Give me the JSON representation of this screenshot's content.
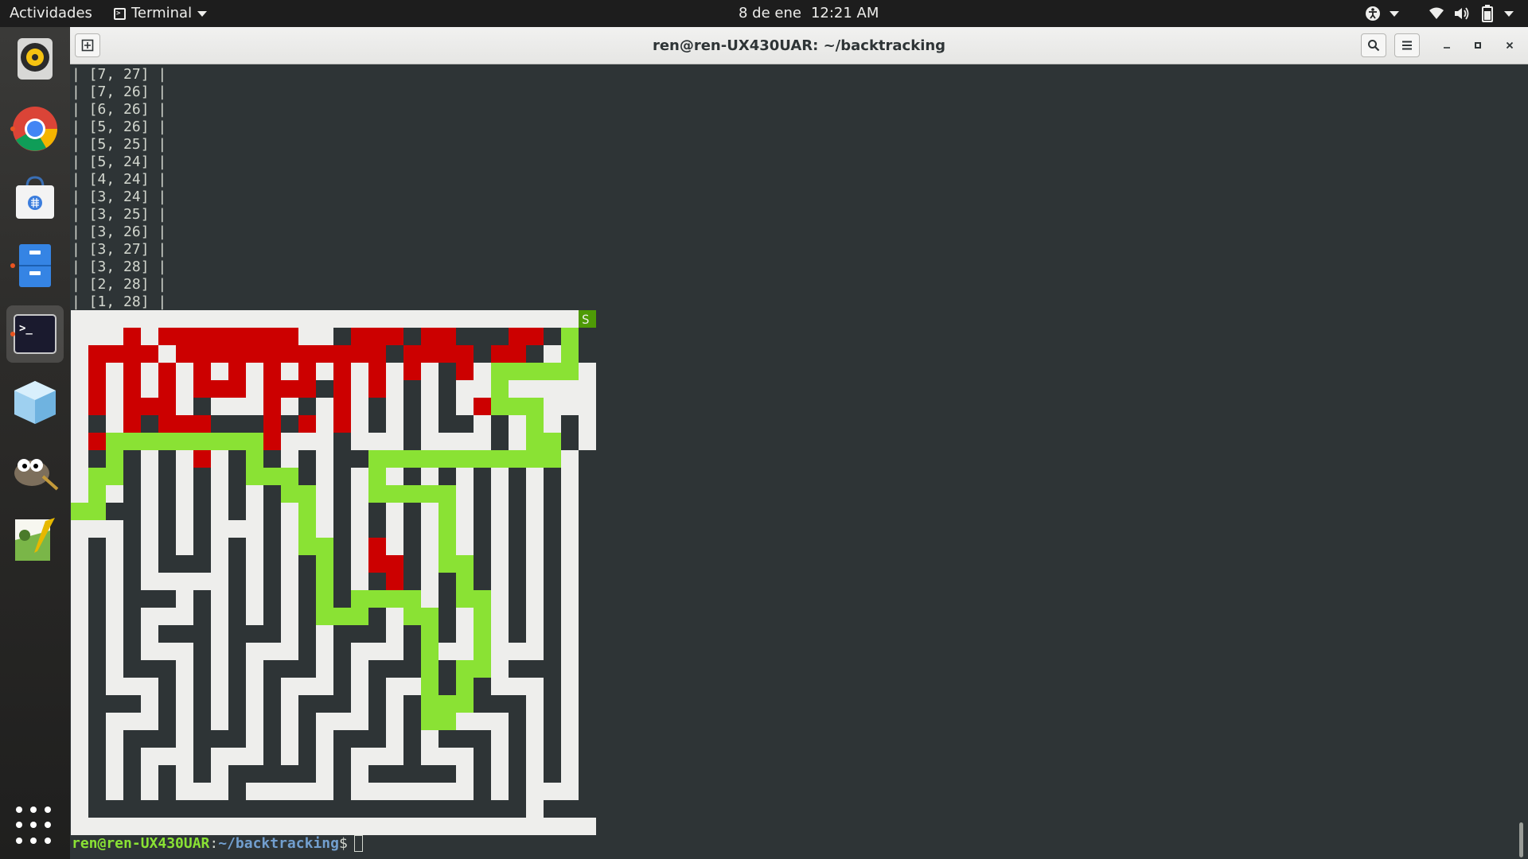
{
  "topbar": {
    "activities": "Actividades",
    "app_menu_label": "Terminal",
    "date": "8 de ene",
    "time": "12:21 AM",
    "tray_icons": [
      "accessibility-icon",
      "wifi-icon",
      "volume-icon",
      "battery-icon"
    ]
  },
  "dock": {
    "apps": [
      {
        "name": "rhythmbox",
        "running": false
      },
      {
        "name": "chrome",
        "running": true
      },
      {
        "name": "software-store",
        "running": false
      },
      {
        "name": "files",
        "running": true
      },
      {
        "name": "terminal",
        "running": true,
        "active": true
      },
      {
        "name": "virtual-box-cube",
        "running": false
      },
      {
        "name": "gimp",
        "running": false
      },
      {
        "name": "office-writer",
        "running": false
      }
    ]
  },
  "window": {
    "title": "ren@ren-UX430UAR: ~/backtracking"
  },
  "terminal": {
    "output_lines": [
      "| [7, 27] |",
      "| [7, 26] |",
      "| [6, 26] |",
      "| [5, 26] |",
      "| [5, 25] |",
      "| [5, 24] |",
      "| [4, 24] |",
      "| [3, 24] |",
      "| [3, 25] |",
      "| [3, 26] |",
      "| [3, 27] |",
      "| [3, 28] |",
      "| [2, 28] |",
      "| [1, 28] |"
    ],
    "prompt": {
      "user": "ren@ren-UX430UAR",
      "sep": ":",
      "path": "~/backtracking",
      "dollar": "$"
    }
  },
  "maze": {
    "start_label": "S",
    "colors": {
      "open": "#eeeeec",
      "wall": "#2e3436",
      "solution": "#8ae234",
      "dead_end": "#cc0000",
      "start": "#4e9a06"
    },
    "grid": [
      "..............................",
      "...#..#######..#####.#####.###",
      ".####.###########.####.####.##",
      ".#...#.#.#.#...#.#...#..#.....",
      ".#...#.#.#.#.###.#.#.#..#.....",
      ".#...#.#...#.#.#.#.#.#..#.#...",
      ".#.###.#######.#.#.#.##.#.#.#.",
      ".#.#.###.#.#...#...#....#.#.#.",
      ".#.#.#.#.#.#.#.#####.##..#.#.#",
      ".#.#.#.#.#.#.#.#.#.#.#.#.#.#.#",
      ".#.#.#.#.#.#.#.#.#.#.#.#.#.#.#",
      ".###.#.#.#.#.#.#.#.#.#.#.#.#.#",
      "...#.#.#...#.#.#.#.#.#.#.#.#.#",
      ".#.#.#.#.#.#.#.#.#.#.#.#.#.#.#",
      ".#.#.###.#.#.#.#.#.#.#.#.#.#.#",
      ".#.#.....#.#.#.#.#.#.#.#.#.#.#",
      ".#.###.#.#.#.#.#.#.#.#.#.#.#.#",
      ".#.#...#.#.#.#...#.#.#.#.#.#.#",
      ".#.#.###.###.#.###.#.#.#.#.#.#",
      ".#.#...#.#...#.#...#...#...#.#",
      ".#.###.#.#.###.#.#####.#.###.#",
      ".#...#.#.#.#...#.#...#.#...#.#",
      ".###.#.#.#.#.###.#.#.#.###.#.#",
      ".#...#.#.#.#.#...#.#.#...#.#.#",
      ".#.###.###.#.#.###.#.###.#.#.#",
      ".#.#...#...#.#.#...#...#.#.#.#",
      ".#.#.#.#.#####.#.#####.#.#.#.#",
      ".#.#.#...#.....#.......#.#...#",
      ".#########################.###",
      ".............................."
    ],
    "solution_path": [
      [
        0,
        29
      ],
      [
        1,
        28
      ],
      [
        2,
        28
      ],
      [
        3,
        28
      ],
      [
        3,
        27
      ],
      [
        3,
        26
      ],
      [
        3,
        25
      ],
      [
        3,
        24
      ],
      [
        4,
        24
      ],
      [
        5,
        24
      ],
      [
        5,
        25
      ],
      [
        5,
        26
      ],
      [
        6,
        26
      ],
      [
        7,
        26
      ],
      [
        7,
        27
      ],
      [
        8,
        27
      ],
      [
        8,
        26
      ],
      [
        8,
        25
      ],
      [
        8,
        24
      ],
      [
        8,
        23
      ],
      [
        8,
        22
      ],
      [
        8,
        21
      ],
      [
        8,
        20
      ],
      [
        8,
        19
      ],
      [
        8,
        18
      ],
      [
        8,
        17
      ],
      [
        9,
        17
      ],
      [
        10,
        17
      ],
      [
        10,
        18
      ],
      [
        10,
        19
      ],
      [
        10,
        20
      ],
      [
        10,
        21
      ],
      [
        11,
        21
      ],
      [
        12,
        21
      ],
      [
        13,
        21
      ],
      [
        14,
        21
      ],
      [
        14,
        22
      ],
      [
        15,
        22
      ],
      [
        16,
        22
      ],
      [
        16,
        23
      ],
      [
        17,
        23
      ],
      [
        18,
        23
      ],
      [
        19,
        23
      ],
      [
        20,
        23
      ],
      [
        20,
        22
      ],
      [
        21,
        22
      ],
      [
        22,
        22
      ],
      [
        22,
        21
      ],
      [
        23,
        21
      ],
      [
        23,
        20
      ],
      [
        22,
        20
      ],
      [
        21,
        20
      ],
      [
        20,
        20
      ],
      [
        19,
        20
      ],
      [
        18,
        20
      ],
      [
        17,
        20
      ],
      [
        17,
        19
      ],
      [
        16,
        19
      ],
      [
        16,
        18
      ],
      [
        16,
        17
      ],
      [
        16,
        16
      ],
      [
        17,
        16
      ],
      [
        17,
        15
      ],
      [
        17,
        14
      ],
      [
        16,
        14
      ],
      [
        15,
        14
      ],
      [
        14,
        14
      ],
      [
        13,
        14
      ],
      [
        13,
        13
      ],
      [
        12,
        13
      ],
      [
        11,
        13
      ],
      [
        10,
        13
      ],
      [
        10,
        12
      ],
      [
        9,
        12
      ],
      [
        9,
        11
      ],
      [
        9,
        10
      ],
      [
        8,
        10
      ],
      [
        7,
        10
      ],
      [
        7,
        9
      ],
      [
        7,
        8
      ],
      [
        7,
        7
      ],
      [
        7,
        6
      ],
      [
        7,
        5
      ],
      [
        7,
        4
      ],
      [
        7,
        3
      ],
      [
        7,
        2
      ],
      [
        8,
        2
      ],
      [
        9,
        2
      ],
      [
        9,
        1
      ],
      [
        10,
        1
      ],
      [
        11,
        1
      ],
      [
        11,
        0
      ]
    ],
    "dead_ends": [
      [
        1,
        3
      ],
      [
        1,
        5
      ],
      [
        1,
        6
      ],
      [
        1,
        7
      ],
      [
        1,
        8
      ],
      [
        1,
        9
      ],
      [
        1,
        10
      ],
      [
        1,
        11
      ],
      [
        1,
        12
      ],
      [
        1,
        16
      ],
      [
        1,
        17
      ],
      [
        1,
        18
      ],
      [
        1,
        20
      ],
      [
        1,
        21
      ],
      [
        1,
        25
      ],
      [
        1,
        26
      ],
      [
        2,
        1
      ],
      [
        2,
        2
      ],
      [
        2,
        3
      ],
      [
        2,
        4
      ],
      [
        2,
        6
      ],
      [
        2,
        7
      ],
      [
        2,
        8
      ],
      [
        2,
        9
      ],
      [
        2,
        10
      ],
      [
        2,
        11
      ],
      [
        2,
        12
      ],
      [
        2,
        13
      ],
      [
        2,
        14
      ],
      [
        2,
        15
      ],
      [
        2,
        16
      ],
      [
        2,
        17
      ],
      [
        2,
        19
      ],
      [
        2,
        20
      ],
      [
        2,
        21
      ],
      [
        2,
        22
      ],
      [
        2,
        24
      ],
      [
        2,
        25
      ],
      [
        3,
        1
      ],
      [
        3,
        3
      ],
      [
        3,
        5
      ],
      [
        3,
        7
      ],
      [
        3,
        9
      ],
      [
        3,
        11
      ],
      [
        3,
        13
      ],
      [
        3,
        15
      ],
      [
        3,
        17
      ],
      [
        3,
        19
      ],
      [
        3,
        22
      ],
      [
        4,
        1
      ],
      [
        4,
        3
      ],
      [
        4,
        5
      ],
      [
        4,
        7
      ],
      [
        4,
        8
      ],
      [
        4,
        9
      ],
      [
        4,
        11
      ],
      [
        4,
        12
      ],
      [
        4,
        13
      ],
      [
        4,
        15
      ],
      [
        4,
        17
      ],
      [
        5,
        1
      ],
      [
        5,
        3
      ],
      [
        5,
        4
      ],
      [
        5,
        5
      ],
      [
        5,
        11
      ],
      [
        5,
        15
      ],
      [
        5,
        23
      ],
      [
        6,
        3
      ],
      [
        6,
        5
      ],
      [
        6,
        6
      ],
      [
        6,
        7
      ],
      [
        6,
        11
      ],
      [
        6,
        13
      ],
      [
        6,
        15
      ],
      [
        7,
        1
      ],
      [
        7,
        4
      ],
      [
        7,
        11
      ],
      [
        8,
        7
      ],
      [
        13,
        17
      ],
      [
        14,
        17
      ],
      [
        14,
        18
      ],
      [
        15,
        18
      ]
    ]
  }
}
